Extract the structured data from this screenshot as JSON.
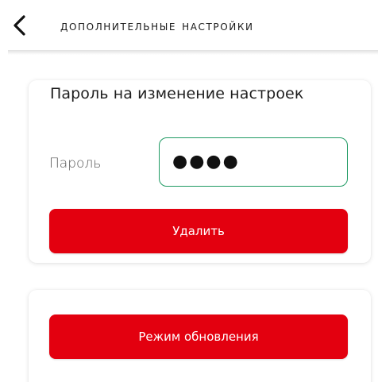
{
  "header": {
    "title": "Дополнительные настройки",
    "back_icon": "chevron-left-icon"
  },
  "password_card": {
    "title": "Пароль на изменение настроек",
    "field_label": "Пароль",
    "password_value": "●●●●",
    "delete_button": "Удалить"
  },
  "update_card": {
    "update_button": "Режим обновления"
  },
  "colors": {
    "accent_red": "#e3000f",
    "input_border_green": "#1f9a63"
  }
}
